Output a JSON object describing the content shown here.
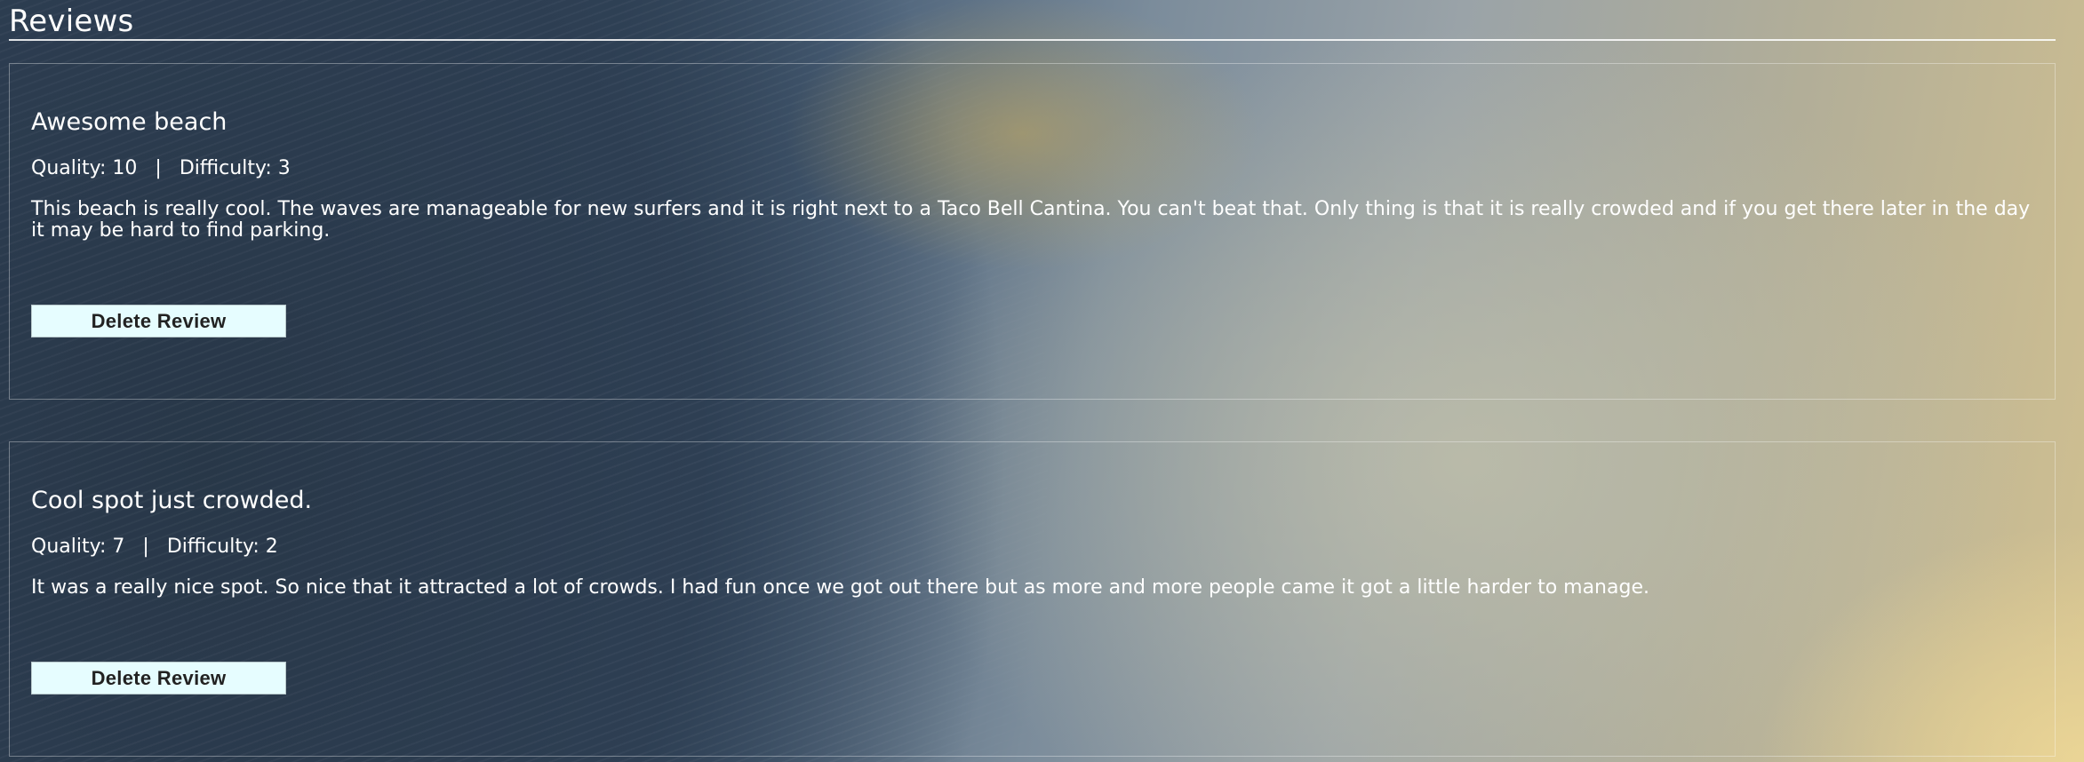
{
  "page": {
    "title": "Reviews"
  },
  "reviews": [
    {
      "title": "Awesome beach",
      "quality_label": "Quality: 10",
      "separator": "|",
      "difficulty_label": "Difficulty: 3",
      "body": "This beach is really cool. The waves are manageable for new surfers and it is right next to a Taco Bell Cantina. You can't beat that. Only thing is that it is really crowded and if you get there later in the day it may be hard to find parking.",
      "delete_label": "Delete Review"
    },
    {
      "title": "Cool spot just crowded.",
      "quality_label": "Quality: 7",
      "separator": "|",
      "difficulty_label": "Difficulty: 2",
      "body": "It was a really nice spot. So nice that it attracted a lot of crowds. I had fun once we got out there but as more and more people came it got a little harder to manage.",
      "delete_label": "Delete Review"
    }
  ],
  "colors": {
    "text": "#ffffff",
    "button_bg": "#e6fdff",
    "button_text": "#222222"
  }
}
